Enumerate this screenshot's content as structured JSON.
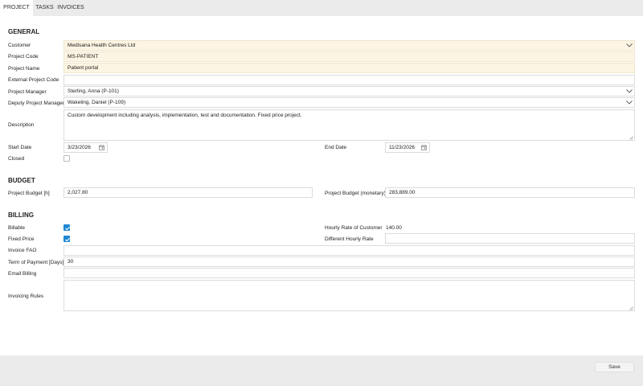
{
  "tabs": [
    {
      "label": "PROJECT"
    },
    {
      "label": "TASKS"
    },
    {
      "label": "INVOICES"
    }
  ],
  "general": {
    "title": "GENERAL",
    "customer_label": "Customer",
    "customer_value": "Medisana Health Centres Ltd",
    "project_code_label": "Project Code",
    "project_code_value": "MS-PATIENT",
    "project_name_label": "Project Name",
    "project_name_value": "Patient portal",
    "external_code_label": "External Project Code",
    "external_code_value": "",
    "manager_label": "Project Manager",
    "manager_value": "Sterling, Anna (P-101)",
    "deputy_label": "Deputy Project Manager",
    "deputy_value": "Wakeling, Daniel (P-109)",
    "description_label": "Description",
    "description_value": "Custom development including analysis, implementation, test and documentation. Fixed price project.",
    "start_label": "Start Date",
    "start_value": "3/23/2026",
    "end_label": "End Date",
    "end_value": "11/23/2026",
    "closed_label": "Closed"
  },
  "budget": {
    "title": "BUDGET",
    "hours_label": "Project Budget [h]",
    "hours_value": "2,027.80",
    "monetary_label": "Project Budget (monetary)",
    "monetary_value": "283,889.00"
  },
  "billing": {
    "title": "BILLING",
    "billable_label": "Billable",
    "billable_checked": true,
    "fixed_price_label": "Fixed Price",
    "fixed_price_checked": true,
    "hourly_rate_label": "Hourly Rate of Customer",
    "hourly_rate_value": "140.00",
    "different_rate_label": "Different Hourly Rate",
    "different_rate_value": "",
    "invoice_fao_label": "Invoice FAO",
    "invoice_fao_value": "",
    "term_label": "Term of Payment [Days]",
    "term_value": "30",
    "email_label": "Email Billing",
    "email_value": "",
    "rules_label": "Invoicing Rules",
    "rules_value": ""
  },
  "footer": {
    "save_label": "Save"
  },
  "colors": {
    "accent": "#1e88d4",
    "required_bg": "#fdf5e3",
    "tabbar_bg": "#ebebeb"
  }
}
